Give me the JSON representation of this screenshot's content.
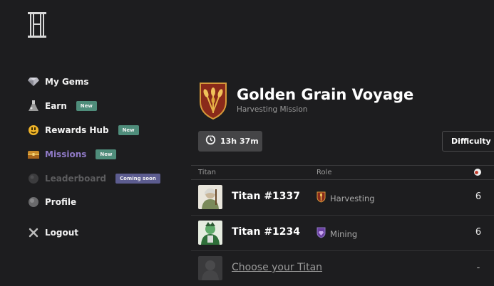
{
  "sidebar": {
    "items": [
      {
        "label": "My Gems",
        "icon": "gem-icon",
        "state": "normal",
        "badge": ""
      },
      {
        "label": "Earn",
        "icon": "flask-icon",
        "state": "normal",
        "badge": "New"
      },
      {
        "label": "Rewards Hub",
        "icon": "smiley-coin-icon",
        "state": "normal",
        "badge": "New"
      },
      {
        "label": "Missions",
        "icon": "treasure-chest-icon",
        "state": "active",
        "badge": "New"
      },
      {
        "label": "Leaderboard",
        "icon": "orb-icon",
        "state": "disabled",
        "badge": "Coming soon"
      },
      {
        "label": "Profile",
        "icon": "sphere-icon",
        "state": "normal",
        "badge": ""
      }
    ],
    "logout_label": "Logout"
  },
  "mission": {
    "title": "Golden Grain Voyage",
    "subtitle": "Harvesting Mission",
    "timer": "13h 37m",
    "difficulty_label": "Difficulty"
  },
  "table": {
    "headers": [
      "Titan",
      "Role"
    ],
    "rows": [
      {
        "titan": "Titan #1337",
        "role": "Harvesting",
        "value": "6"
      },
      {
        "titan": "Titan #1234",
        "role": "Mining",
        "value": "6"
      }
    ],
    "choose_label": "Choose your Titan",
    "choose_value": "-"
  },
  "colors": {
    "background": "#1d1d1f",
    "active": "#8f79c6",
    "badge_new": "#4f8d7b",
    "badge_soon": "#5c5c8f"
  }
}
